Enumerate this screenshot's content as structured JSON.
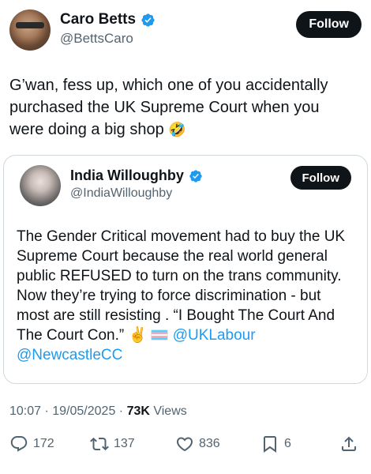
{
  "tweet": {
    "author": {
      "display_name": "Caro Betts",
      "handle": "@BettsCaro",
      "verified": true
    },
    "follow_label": "Follow",
    "text": "G’wan, fess up, which one of you accidentally purchased the UK Supreme Court when you were doing a big shop",
    "emoji": "🤣",
    "timestamp": "10:07 · 19/05/2025 · ",
    "views_count": "73K",
    "views_label": " Views",
    "stats": {
      "replies": "172",
      "retweets": "137",
      "likes": "836",
      "bookmarks": "6"
    }
  },
  "quoted_tweet": {
    "author": {
      "display_name": "India Willoughby",
      "handle": "@IndiaWilloughby",
      "verified": true
    },
    "follow_label": "Follow",
    "text": "The Gender Critical movement had to buy the UK Supreme Court because the real world general public REFUSED to turn on the trans community. Now they’re trying to force discrimination - but most are still resisting . “I Bought The Court And The Court Con.” ",
    "emoji": "✌️",
    "mentions": [
      "@UKLabour",
      "@NewcastleCC"
    ]
  },
  "colors": {
    "accent": "#1d9bf0",
    "text": "#0f1419",
    "muted": "#536471",
    "border": "#cfd9de"
  },
  "icons": [
    "verified-badge-icon",
    "reply-icon",
    "retweet-icon",
    "like-icon",
    "bookmark-icon",
    "share-icon",
    "transgender-flag-icon"
  ]
}
